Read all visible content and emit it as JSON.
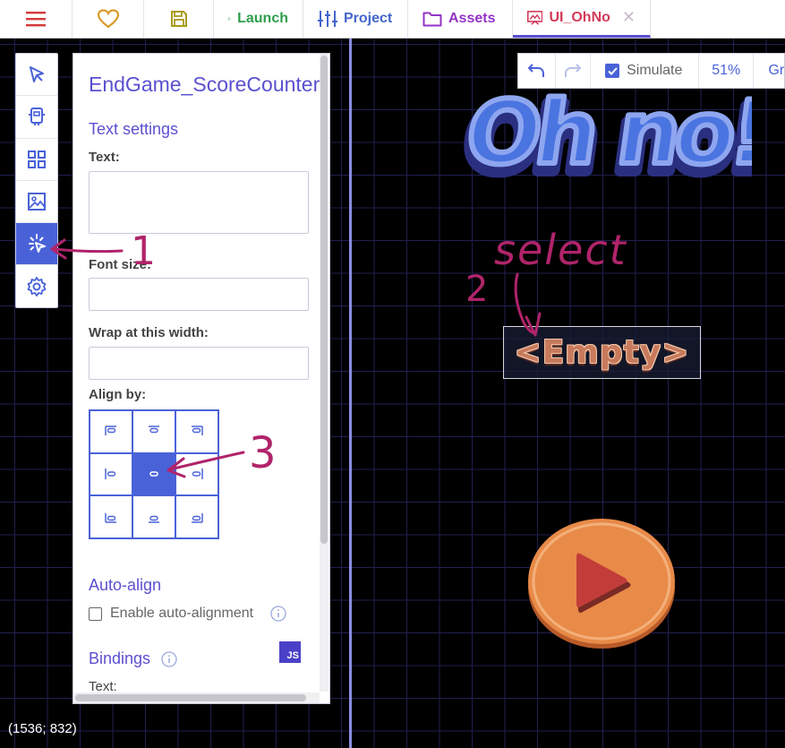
{
  "tabs": {
    "menu_icon": "hamburger-menu-icon",
    "favorite_icon": "heart-icon",
    "save_icon": "floppy-disk-icon",
    "launch": "Launch",
    "project": "Project",
    "assets": "Assets",
    "active": "UI_OhNo",
    "close_glyph": "✕",
    "colors": {
      "launch": "#2e9e4c",
      "project": "#4466cc",
      "assets": "#9333c9",
      "active": "#d23a5a"
    }
  },
  "tools": [
    {
      "icon": "pointer-icon",
      "active": false
    },
    {
      "icon": "template-icon",
      "active": false
    },
    {
      "icon": "grid-icon",
      "active": false
    },
    {
      "icon": "image-icon",
      "active": false
    },
    {
      "icon": "text-click-icon",
      "active": true
    },
    {
      "icon": "settings-gear-icon",
      "active": false
    }
  ],
  "panel": {
    "title": "EndGame_ScoreCounter",
    "text_settings": "Text settings",
    "text_label": "Text:",
    "text_value": "",
    "font_size_label": "Font size:",
    "font_size_value": "",
    "wrap_label": "Wrap at this width:",
    "wrap_value": "",
    "align_label": "Align by:",
    "align_selected": "center-middle",
    "auto_align_heading": "Auto-align",
    "auto_align_checkbox": "Enable auto-alignment",
    "auto_align_checked": false,
    "bindings_heading": "Bindings",
    "js_badge": "JS",
    "bindings_text_label": "Text:"
  },
  "viewport_toolbar": {
    "undo_icon": "undo-icon",
    "redo_icon": "redo-icon",
    "simulate_label": "Simulate",
    "simulate_checked": true,
    "zoom": "51%",
    "grid_label": "Gr"
  },
  "scene": {
    "title_text": "Oh no!",
    "empty_label": "<Empty>",
    "play_icon": "play-button-icon"
  },
  "annotations": {
    "label_1": "1",
    "label_2": "2",
    "label_3": "3",
    "select_word": "select",
    "color": "#b0246a"
  },
  "status": {
    "coords": "(1536; 832)"
  },
  "accent_color": "#4a62d8"
}
